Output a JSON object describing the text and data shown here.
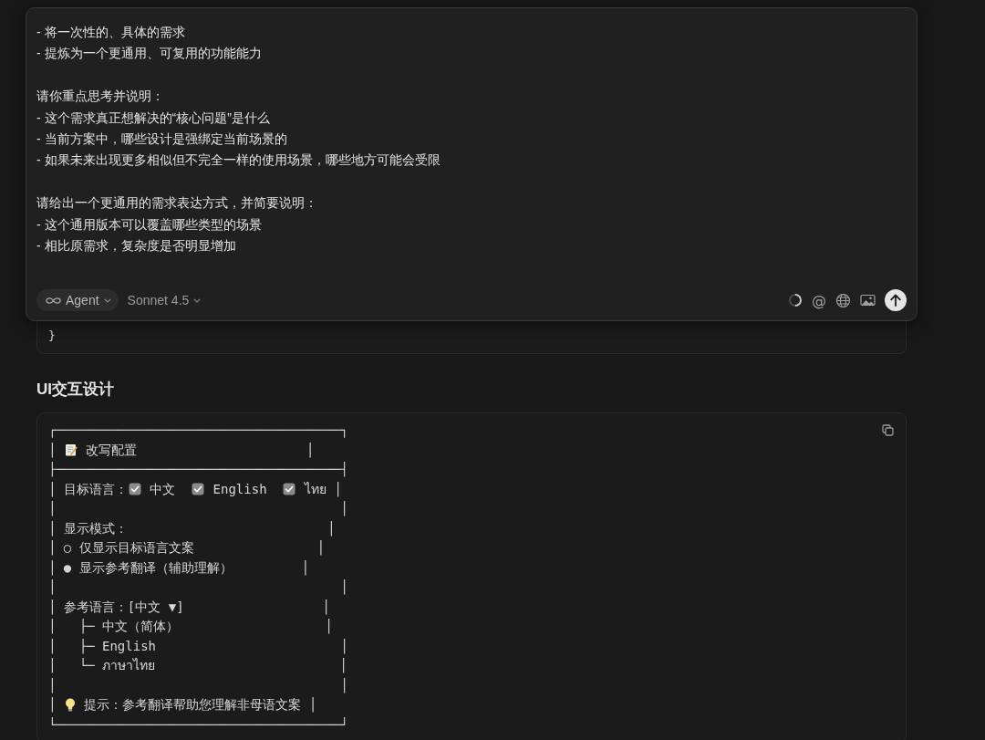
{
  "composer": {
    "paragraphs": [
      [
        "- 将一次性的、具体的需求",
        "- 提炼为一个更通用、可复用的功能能力"
      ],
      [
        "请你重点思考并说明：",
        "- 这个需求真正想解决的“核心问题”是什么",
        "- 当前方案中，哪些设计是强绑定当前场景的",
        "- 如果未来出现更多相似但不完全一样的使用场景，哪些地方可能会受限"
      ],
      [
        "请给出一个更通用的需求表达方式，并简要说明：",
        "- 这个通用版本可以覆盖哪些类型的场景",
        "- 相比原需求，复杂度是否明显增加"
      ]
    ],
    "mode": {
      "label": "Agent"
    },
    "model": {
      "label": "Sonnet 4.5"
    },
    "mention_button": "@"
  },
  "previous_code": {
    "lines": [
      "}"
    ]
  },
  "heading": "UI交互设计",
  "code_block": {
    "lines": [
      [
        {
          "kind": "text",
          "text": "┌─────────────────────────────────────┐"
        }
      ],
      [
        {
          "kind": "text",
          "text": "│ "
        },
        {
          "kind": "memo"
        },
        {
          "kind": "text",
          "text": " 改写配置                      │"
        }
      ],
      [
        {
          "kind": "text",
          "text": "├─────────────────────────────────────┤"
        }
      ],
      [
        {
          "kind": "text",
          "text": "│ 目标语言："
        },
        {
          "kind": "checkbox",
          "checked": true
        },
        {
          "kind": "text",
          "text": " 中文  "
        },
        {
          "kind": "checkbox",
          "checked": true
        },
        {
          "kind": "text",
          "text": " English  "
        },
        {
          "kind": "checkbox",
          "checked": true
        },
        {
          "kind": "text",
          "text": " ไทย │"
        }
      ],
      [
        {
          "kind": "text",
          "text": "│                                     │"
        }
      ],
      [
        {
          "kind": "text",
          "text": "│ 显示模式：                          │"
        }
      ],
      [
        {
          "kind": "text",
          "text": "│ ○ 仅显示目标语言文案                │"
        }
      ],
      [
        {
          "kind": "text",
          "text": "│ ● 显示参考翻译（辅助理解）         │"
        }
      ],
      [
        {
          "kind": "text",
          "text": "│                                     │"
        }
      ],
      [
        {
          "kind": "text",
          "text": "│ 参考语言：[中文 ▼]                  │"
        }
      ],
      [
        {
          "kind": "text",
          "text": "│   ├─ 中文（简体）                   │"
        }
      ],
      [
        {
          "kind": "text",
          "text": "│   ├─ English                        │"
        }
      ],
      [
        {
          "kind": "text",
          "text": "│   └─ ภาษาไทย                        │"
        }
      ],
      [
        {
          "kind": "text",
          "text": "│                                     │"
        }
      ],
      [
        {
          "kind": "text",
          "text": "│ "
        },
        {
          "kind": "bulb"
        },
        {
          "kind": "text",
          "text": " 提示：参考翻译帮助您理解非母语文案 │"
        }
      ],
      [
        {
          "kind": "text",
          "text": "└─────────────────────────────────────┘"
        }
      ]
    ]
  }
}
